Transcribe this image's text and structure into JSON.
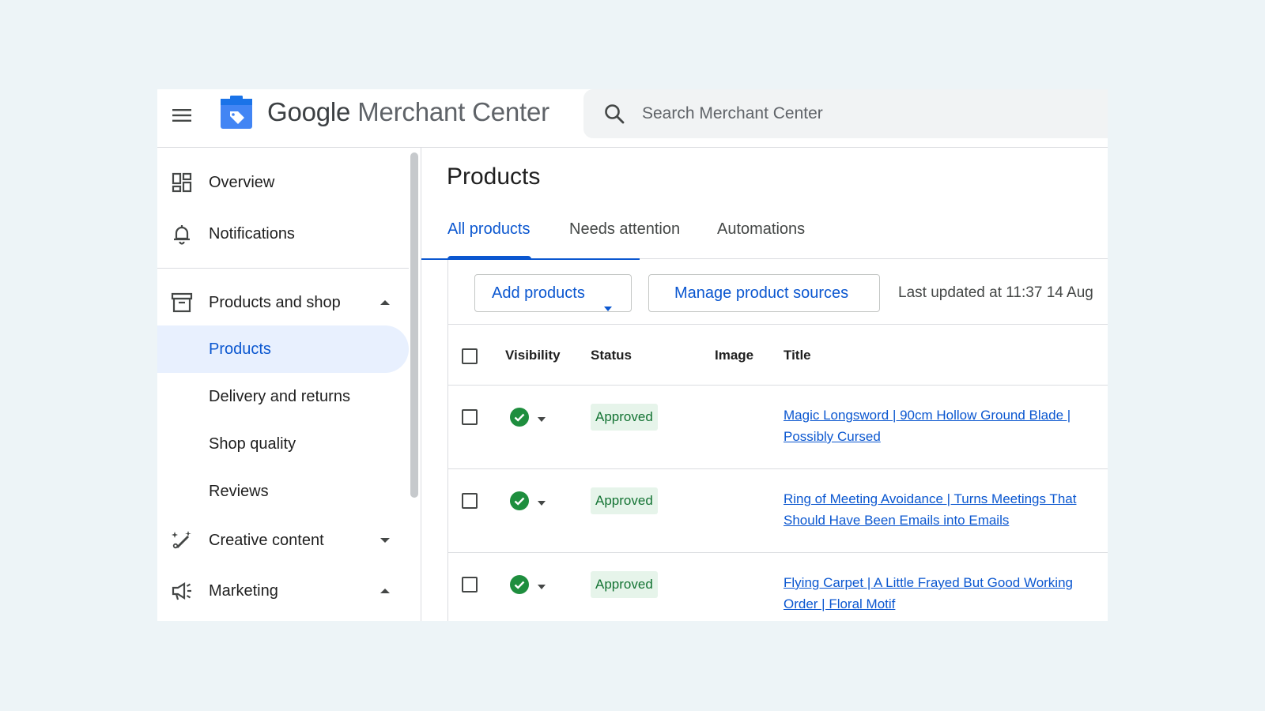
{
  "header": {
    "logo_google": "Google",
    "logo_product": "Merchant Center",
    "search_placeholder": "Search Merchant Center",
    "brand_color": "#4285f4"
  },
  "sidebar": {
    "items": [
      {
        "label": "Overview",
        "icon": "dashboard-icon"
      },
      {
        "label": "Notifications",
        "icon": "bell-icon"
      },
      {
        "label": "Products and shop",
        "icon": "archive-box-icon",
        "expanded": true
      },
      {
        "label": "Products",
        "active": true
      },
      {
        "label": "Delivery and returns"
      },
      {
        "label": "Shop quality"
      },
      {
        "label": "Reviews"
      },
      {
        "label": "Creative content",
        "icon": "magic-wand-icon",
        "expanded": false
      },
      {
        "label": "Marketing",
        "icon": "megaphone-icon",
        "expanded": true
      }
    ]
  },
  "main": {
    "title": "Products",
    "tabs": [
      {
        "label": "All products",
        "active": true
      },
      {
        "label": "Needs attention"
      },
      {
        "label": "Automations"
      }
    ],
    "toolbar": {
      "add_products": "Add products",
      "manage_sources": "Manage product sources",
      "last_updated": "Last updated at 11:37 14 Aug"
    },
    "table": {
      "columns": [
        "Visibility",
        "Status",
        "Image",
        "Title"
      ],
      "rows": [
        {
          "visibility": "visible",
          "status": "Approved",
          "title": "Magic Longsword | 90cm Hollow Ground Blade | Possibly Cursed"
        },
        {
          "visibility": "visible",
          "status": "Approved",
          "title": "Ring of Meeting Avoidance | Turns Meetings That Should Have Been Emails into Emails"
        },
        {
          "visibility": "visible",
          "status": "Approved",
          "title": "Flying Carpet | A Little Frayed But Good Working Order | Floral Motif"
        }
      ]
    }
  },
  "colors": {
    "accent": "#0b57d0",
    "active_nav_bg": "#e8f0fe",
    "approved_bg": "#e6f4ea",
    "approved_text": "#137333",
    "visible_check": "#1e8e3e",
    "page_bg": "#edf4f7"
  }
}
